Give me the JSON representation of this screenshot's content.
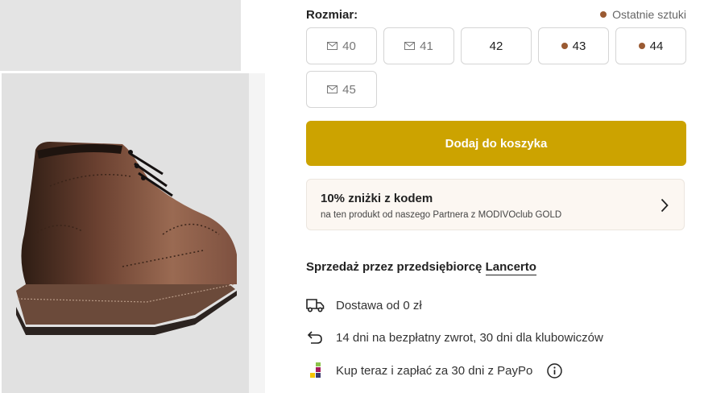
{
  "size_section": {
    "label": "Rozmiar:",
    "stock_note": "Ostatnie sztuki",
    "sizes": [
      {
        "value": "40",
        "status": "notify"
      },
      {
        "value": "41",
        "status": "notify"
      },
      {
        "value": "42",
        "status": "available"
      },
      {
        "value": "43",
        "status": "last-items"
      },
      {
        "value": "44",
        "status": "last-items"
      },
      {
        "value": "45",
        "status": "notify"
      }
    ]
  },
  "cart": {
    "add_label": "Dodaj do koszyka"
  },
  "promo": {
    "title": "10% zniżki z kodem",
    "subtitle": "na ten produkt od naszego Partnera z MODIVOclub GOLD"
  },
  "seller": {
    "prefix": "Sprzedaż przez przedsiębiorcę",
    "name": "Lancerto"
  },
  "benefits": {
    "delivery": "Dostawa od 0 zł",
    "returns": "14 dni na bezpłatny zwrot, 30 dni dla klubowiczów",
    "paypo": "Kup teraz i zapłać za 30 dni z PayPo"
  },
  "colors": {
    "accent": "#cca300",
    "last_items_dot": "#9a5a32",
    "promo_bg": "#fcf7f2"
  },
  "icons": {
    "notify": "envelope-icon",
    "delivery": "truck-icon",
    "returns": "return-arrow-icon",
    "paypo": "paypo-logo-icon",
    "info": "info-icon",
    "promo_arrow": "chevron-right-icon"
  }
}
